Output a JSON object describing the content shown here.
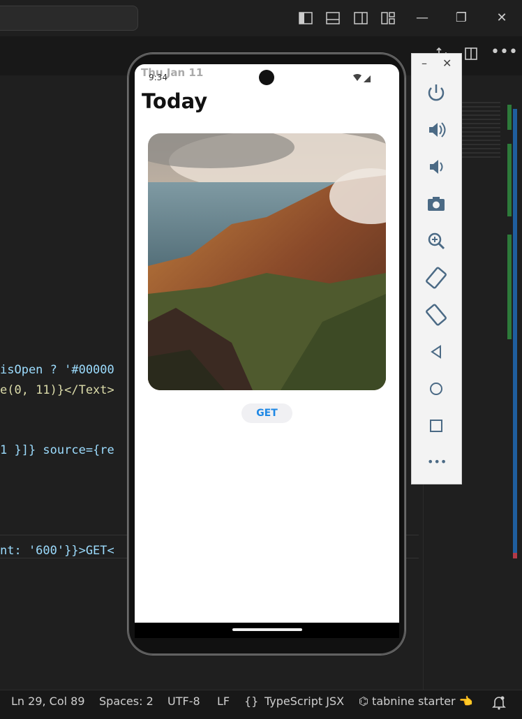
{
  "window": {
    "minimize": "—",
    "restore": "❐",
    "close": "✕"
  },
  "editor_lines": [
    {
      "text": "isOpen ? '#00000"
    },
    {
      "text": "e(0, 11)}</Text>"
    },
    {
      "text": "1 }]} source={re"
    },
    {
      "text": "nt: '600'}}>GET<"
    }
  ],
  "statusbar": {
    "position": "Ln 29, Col 89",
    "spaces": "Spaces: 2",
    "encoding": "UTF-8",
    "eol": "LF",
    "lang_braces": "{}",
    "language": "TypeScript JSX",
    "tabnine": "⌬ tabnine starter 👈"
  },
  "phone": {
    "status_time": "9:34",
    "header_date": "Thu Jan 11",
    "title": "Today",
    "button_label": "GET"
  },
  "emulator": {
    "minimize": "–",
    "close": "✕"
  }
}
